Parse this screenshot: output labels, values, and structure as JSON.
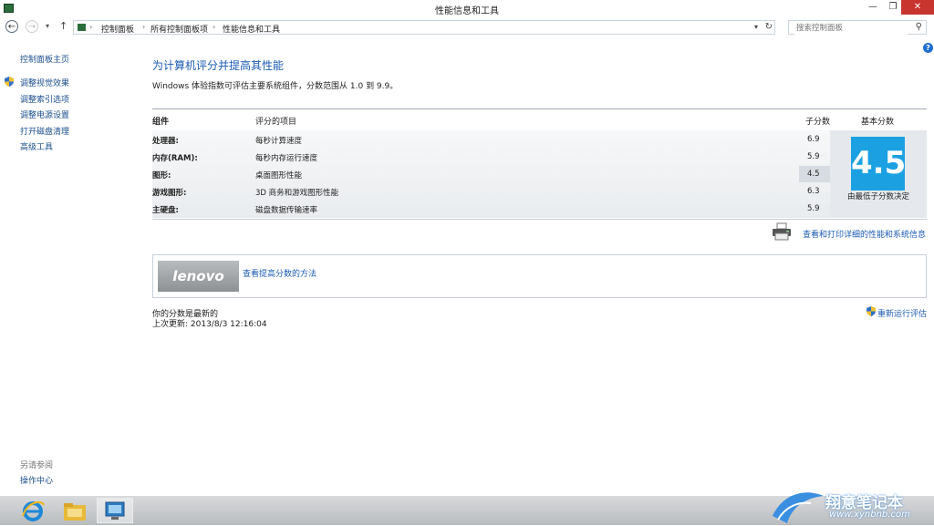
{
  "window": {
    "title": "性能信息和工具",
    "minimize_glyph": "—",
    "maximize_glyph": "❐",
    "close_glyph": "✕"
  },
  "address": {
    "back_glyph": "←",
    "forward_glyph": "→",
    "dropdown_glyph": "▾",
    "up_glyph": "↑",
    "separator_glyph": "›",
    "refresh_glyph": "↻",
    "breadcrumbs": [
      "控制面板",
      "所有控制面板项",
      "性能信息和工具"
    ],
    "search_placeholder": "搜索控制面板"
  },
  "sidebar": {
    "home_link": "控制面板主页",
    "items": [
      "调整视觉效果",
      "调整索引选项",
      "调整电源设置",
      "打开磁盘清理",
      "高级工具"
    ],
    "see_also_label": "另请参阅",
    "action_center": "操作中心"
  },
  "main": {
    "heading": "为计算机评分并提高其性能",
    "description": "Windows 体验指数可评估主要系统组件，分数范围从 1.0 到 9.9。",
    "columns": {
      "component": "组件",
      "rated": "评分的项目",
      "subscore": "子分数",
      "base": "基本分数"
    },
    "rows": [
      {
        "component": "处理器:",
        "item": "每秒计算速度",
        "score": "6.9"
      },
      {
        "component": "内存(RAM):",
        "item": "每秒内存运行速度",
        "score": "5.9"
      },
      {
        "component": "图形:",
        "item": "桌面图形性能",
        "score": "4.5"
      },
      {
        "component": "游戏图形:",
        "item": "3D 商务和游戏图形性能",
        "score": "6.3"
      },
      {
        "component": "主硬盘:",
        "item": "磁盘数据传输速率",
        "score": "5.9"
      }
    ],
    "base_score": "4.5",
    "base_caption": "由最低子分数决定",
    "print_link": "查看和打印详细的性能和系统信息",
    "oem_logo_text": "lenovo",
    "tips_link": "查看提高分数的方法",
    "status_line1": "你的分数是最新的",
    "status_line2": "上次更新: 2013/8/3 12:16:04",
    "rerun_link": "重新运行评估"
  },
  "help_glyph": "?",
  "watermark": {
    "text": "翔意笔记本",
    "url": "www.xynbnb.com"
  },
  "colors": {
    "accent_blue": "#1ba1e2",
    "link_blue": "#1c5bb2",
    "close_red": "#c7352e"
  }
}
